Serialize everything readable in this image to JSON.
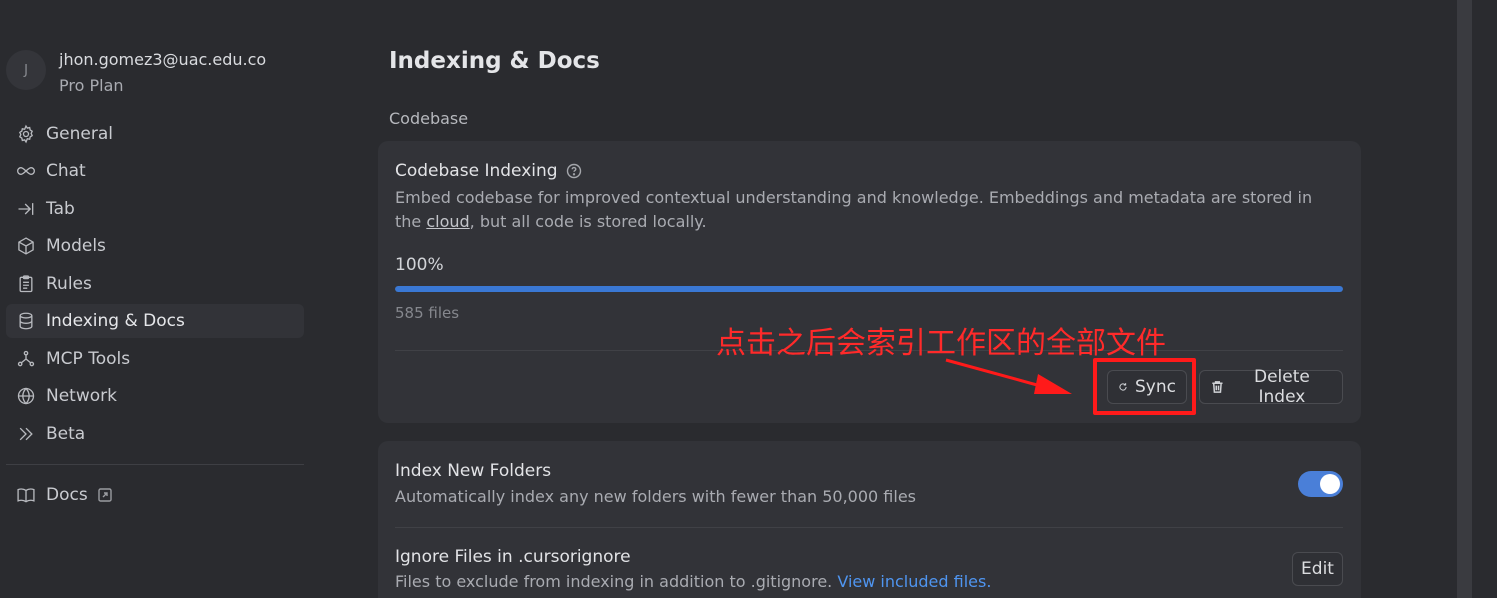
{
  "profile": {
    "avatar_initial": "J",
    "email": "jhon.gomez3@uac.edu.co",
    "plan": "Pro Plan"
  },
  "nav": {
    "items": [
      {
        "label": "General",
        "icon": "gear-icon"
      },
      {
        "label": "Chat",
        "icon": "infinity-icon"
      },
      {
        "label": "Tab",
        "icon": "arrow-right-bar-icon"
      },
      {
        "label": "Models",
        "icon": "cube-icon"
      },
      {
        "label": "Rules",
        "icon": "clipboard-icon"
      },
      {
        "label": "Indexing & Docs",
        "icon": "database-icon",
        "active": true
      },
      {
        "label": "MCP Tools",
        "icon": "nodes-icon"
      },
      {
        "label": "Network",
        "icon": "globe-icon"
      },
      {
        "label": "Beta",
        "icon": "double-chevron-icon"
      }
    ],
    "docs": {
      "label": "Docs",
      "icon": "book-icon"
    }
  },
  "page": {
    "title": "Indexing & Docs",
    "section_label": "Codebase"
  },
  "codebase_indexing": {
    "title": "Codebase Indexing",
    "desc_before": "Embed codebase for improved contextual understanding and knowledge. Embeddings and metadata are stored in the ",
    "desc_link": "cloud",
    "desc_after": ", but all code is stored locally.",
    "percent_label": "100%",
    "progress": 1.0,
    "files_label": "585 files",
    "sync_label": "Sync",
    "delete_label": "Delete Index"
  },
  "annotation": {
    "text": "点击之后会索引工作区的全部文件",
    "color": "#ff2a2a"
  },
  "settings": {
    "index_new_folders": {
      "title": "Index New Folders",
      "desc": "Automatically index any new folders with fewer than 50,000 files",
      "enabled": true
    },
    "ignore_files": {
      "title": "Ignore Files in .cursorignore",
      "desc": "Files to exclude from indexing in addition to .gitignore. ",
      "link": "View included files.",
      "edit_label": "Edit"
    }
  },
  "colors": {
    "accent": "#3a78d4",
    "link": "#4f95f0",
    "background": "#2a2b2f",
    "card": "#323338"
  }
}
